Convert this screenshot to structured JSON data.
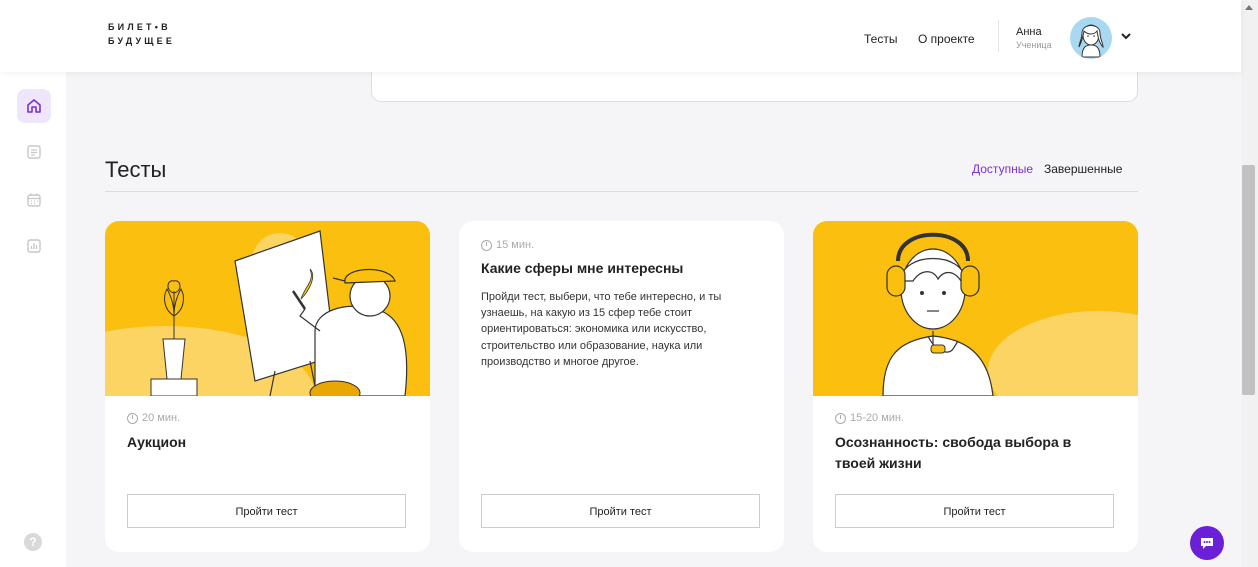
{
  "header": {
    "logo_line1": "БИЛЕТ•В",
    "logo_line2": "БУДУЩЕЕ",
    "nav": [
      "Тесты",
      "О проекте"
    ],
    "user_name": "Анна",
    "user_role": "Ученица"
  },
  "sidebar": {
    "items": [
      "home-icon",
      "list-icon",
      "calendar-icon",
      "chart-icon"
    ],
    "help_label": "?"
  },
  "section": {
    "title": "Тесты",
    "filters": [
      "Доступные",
      "Завершенные"
    ]
  },
  "cards": [
    {
      "duration": "20 мин.",
      "title": "Аукцион",
      "description": "",
      "button": "Пройти тест"
    },
    {
      "duration": "15 мин.",
      "title": "Какие сферы мне интересны",
      "description": "Пройди тест, выбери, что тебе интересно, и ты узнаешь, на какую из 15 сфер тебе стоит ориентироваться: экономика или искусство, строительство или образование, наука или производство и многое другое.",
      "button": "Пройти тест"
    },
    {
      "duration": "15-20 мин.",
      "title": "Осознанность: свобода выбора в твоей жизни",
      "description": "",
      "button": "Пройти тест"
    }
  ],
  "colors": {
    "accent": "#7b2fd6",
    "card_yellow": "#fbbf0f",
    "chat": "#6b1fd6"
  }
}
